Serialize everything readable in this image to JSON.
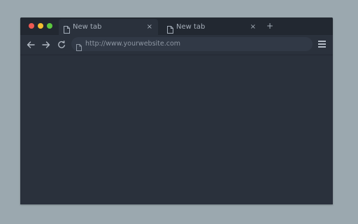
{
  "window": {
    "colors": {
      "background": "#9ba8af",
      "frame": "#2a313c",
      "tabbar": "#222831",
      "urlbar": "#313946"
    },
    "controls": {
      "close_color": "#ee5a52",
      "minimize_color": "#f4be30",
      "zoom_color": "#5cc83f"
    }
  },
  "tabs": [
    {
      "label": "New tab",
      "icon": "document-icon",
      "close_label": "×",
      "active": true
    },
    {
      "label": "New tab",
      "icon": "document-icon",
      "close_label": "×",
      "active": false
    }
  ],
  "new_tab_label": "+",
  "toolbar": {
    "back_icon": "arrow-left-icon",
    "forward_icon": "arrow-right-icon",
    "reload_icon": "reload-icon",
    "menu_icon": "hamburger-menu-icon"
  },
  "address_bar": {
    "url": "http://www.yourwebsite.com",
    "icon": "document-icon"
  }
}
